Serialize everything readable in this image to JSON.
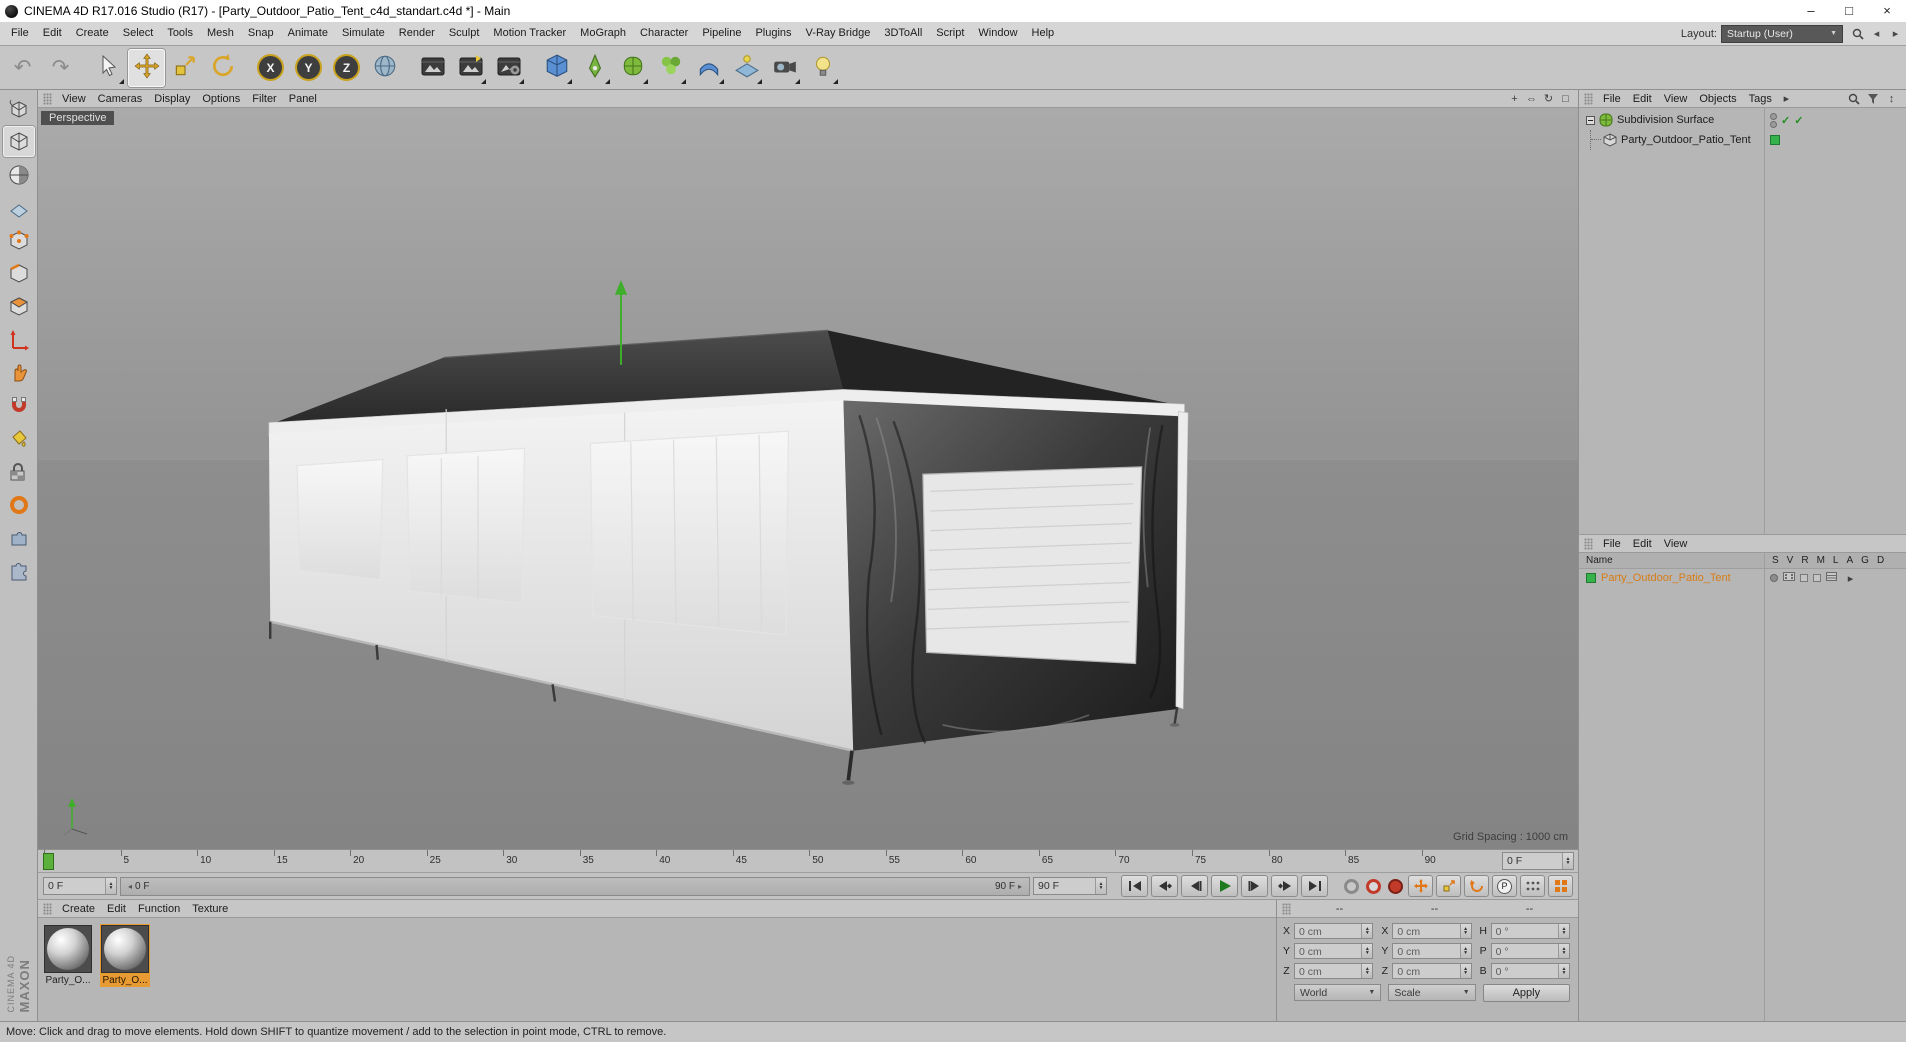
{
  "title_bar": {
    "title": "CINEMA 4D R17.016 Studio (R17) - [Party_Outdoor_Patio_Tent_c4d_standart.c4d *] - Main",
    "minimize": "–",
    "maximize": "□",
    "close": "×"
  },
  "menu_bar": {
    "items": [
      "File",
      "Edit",
      "Create",
      "Select",
      "Tools",
      "Mesh",
      "Snap",
      "Animate",
      "Simulate",
      "Render",
      "Sculpt",
      "Motion Tracker",
      "MoGraph",
      "Character",
      "Pipeline",
      "Plugins",
      "V-Ray Bridge",
      "3DToAll",
      "Script",
      "Window",
      "Help"
    ],
    "layout_label": "Layout:",
    "layout_value": "Startup (User)"
  },
  "toolbar": {
    "axis_x": "X",
    "axis_y": "Y",
    "axis_z": "Z"
  },
  "viewport": {
    "menu": [
      "View",
      "Cameras",
      "Display",
      "Options",
      "Filter",
      "Panel"
    ],
    "camera_label": "Perspective",
    "grid_spacing": "Grid Spacing : 1000 cm"
  },
  "object_manager": {
    "menu": [
      "File",
      "Edit",
      "View",
      "Objects",
      "Tags"
    ],
    "items": [
      "Subdivision Surface",
      "Party_Outdoor_Patio_Tent"
    ]
  },
  "layer_panel": {
    "menu": [
      "File",
      "Edit",
      "View"
    ],
    "name_header": "Name",
    "columns": [
      "S",
      "V",
      "R",
      "M",
      "L",
      "A",
      "G",
      "D"
    ],
    "row_label": "Party_Outdoor_Patio_Tent"
  },
  "timeline": {
    "ticks": [
      "0",
      "5",
      "10",
      "15",
      "20",
      "25",
      "30",
      "35",
      "40",
      "45",
      "50",
      "55",
      "60",
      "65",
      "70",
      "75",
      "80",
      "85",
      "90"
    ],
    "current_frame_field": "0 F",
    "start_field": "0 F",
    "range_start_label": "0 F",
    "range_end_label": "90 F",
    "end_field": "90 F"
  },
  "material_manager": {
    "menu": [
      "Create",
      "Edit",
      "Function",
      "Texture"
    ],
    "materials": [
      "Party_O...",
      "Party_O..."
    ]
  },
  "coordinates": {
    "headers": [
      "--",
      "--",
      "--"
    ],
    "pos_labels": [
      "X",
      "Y",
      "Z"
    ],
    "pos_values": [
      "0 cm",
      "0 cm",
      "0 cm"
    ],
    "size_labels": [
      "X",
      "Y",
      "Z"
    ],
    "size_values": [
      "0 cm",
      "0 cm",
      "0 cm"
    ],
    "rot_labels": [
      "H",
      "P",
      "B"
    ],
    "rot_values": [
      "0 °",
      "0 °",
      "0 °"
    ],
    "system_dropdown": "World",
    "mode_dropdown": "Scale",
    "apply_button": "Apply"
  },
  "status_bar": {
    "text": "Move: Click and drag to move elements. Hold down SHIFT to quantize movement / add to the selection in point mode, CTRL to remove."
  },
  "branding": {
    "line1": "MAXON",
    "line2": "CINEMA 4D"
  },
  "icons": {
    "undo": "↶",
    "redo": "↷",
    "pan_view": "+",
    "zoom_view": "⇔",
    "orbit_view": "↻",
    "toggle_view": "□",
    "caret": "▼",
    "spin_up": "▲",
    "spin_down": "▼",
    "menu_expand": "▸",
    "chev_left": "◂",
    "chev_right": "▸",
    "parameter_key": "P",
    "check": "✓",
    "updown": "↕"
  },
  "colors": {
    "selection_orange": "#e8861a",
    "tag_green": "#35b24a",
    "marker_green": "#5bb13c"
  }
}
